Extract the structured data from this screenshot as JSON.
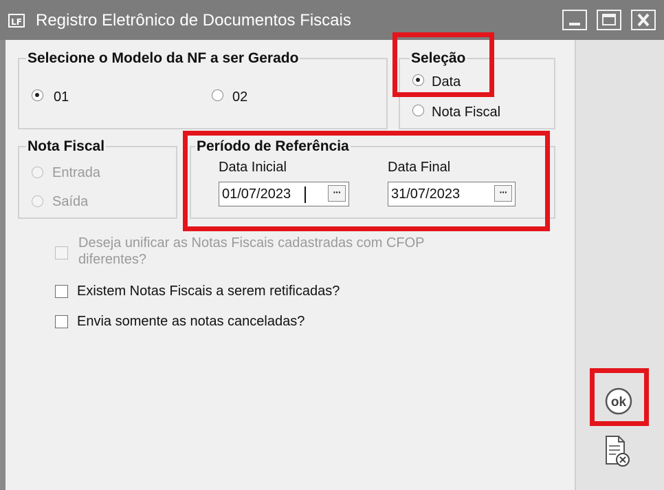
{
  "window": {
    "title": "Registro Eletrônico de Documentos Fiscais",
    "app_icon_text": "LF",
    "buttons": [
      "minimize-icon",
      "maximize-icon",
      "close-icon"
    ]
  },
  "modelo_group": {
    "legend": "Selecione o Modelo da NF a ser Gerado",
    "options": [
      {
        "label": "01",
        "selected": true
      },
      {
        "label": "02",
        "selected": false
      }
    ]
  },
  "selecao_group": {
    "legend": "Seleção",
    "options": [
      {
        "label": "Data",
        "selected": true
      },
      {
        "label": "Nota Fiscal",
        "selected": false
      }
    ]
  },
  "nota_fiscal_group": {
    "legend": "Nota Fiscal",
    "enabled": false,
    "options": [
      {
        "label": "Entrada",
        "selected": false
      },
      {
        "label": "Saída",
        "selected": false
      }
    ]
  },
  "periodo_group": {
    "legend": "Período de Referência",
    "data_inicial": {
      "label": "Data Inicial",
      "value": "01/07/2023",
      "button": "···"
    },
    "data_final": {
      "label": "Data Final",
      "value": "31/07/2023",
      "button": "···"
    }
  },
  "checkboxes": [
    {
      "line1": "Deseja unificar as Notas Fiscais cadastradas com CFOP",
      "line2": "diferentes?",
      "checked": false,
      "enabled": false
    },
    {
      "label": "Existem Notas Fiscais a serem retificadas?",
      "checked": false,
      "enabled": true
    },
    {
      "label": "Envia somente as notas canceladas?",
      "checked": false,
      "enabled": true
    }
  ],
  "side_actions": {
    "ok_icon": "ok-icon",
    "ok_text": "ok",
    "cancel_icon": "document-cancel-icon"
  },
  "colors": {
    "highlight": "#e3151b",
    "titlebar": "#7c7c7c",
    "window_bg": "#f0f0f0"
  }
}
